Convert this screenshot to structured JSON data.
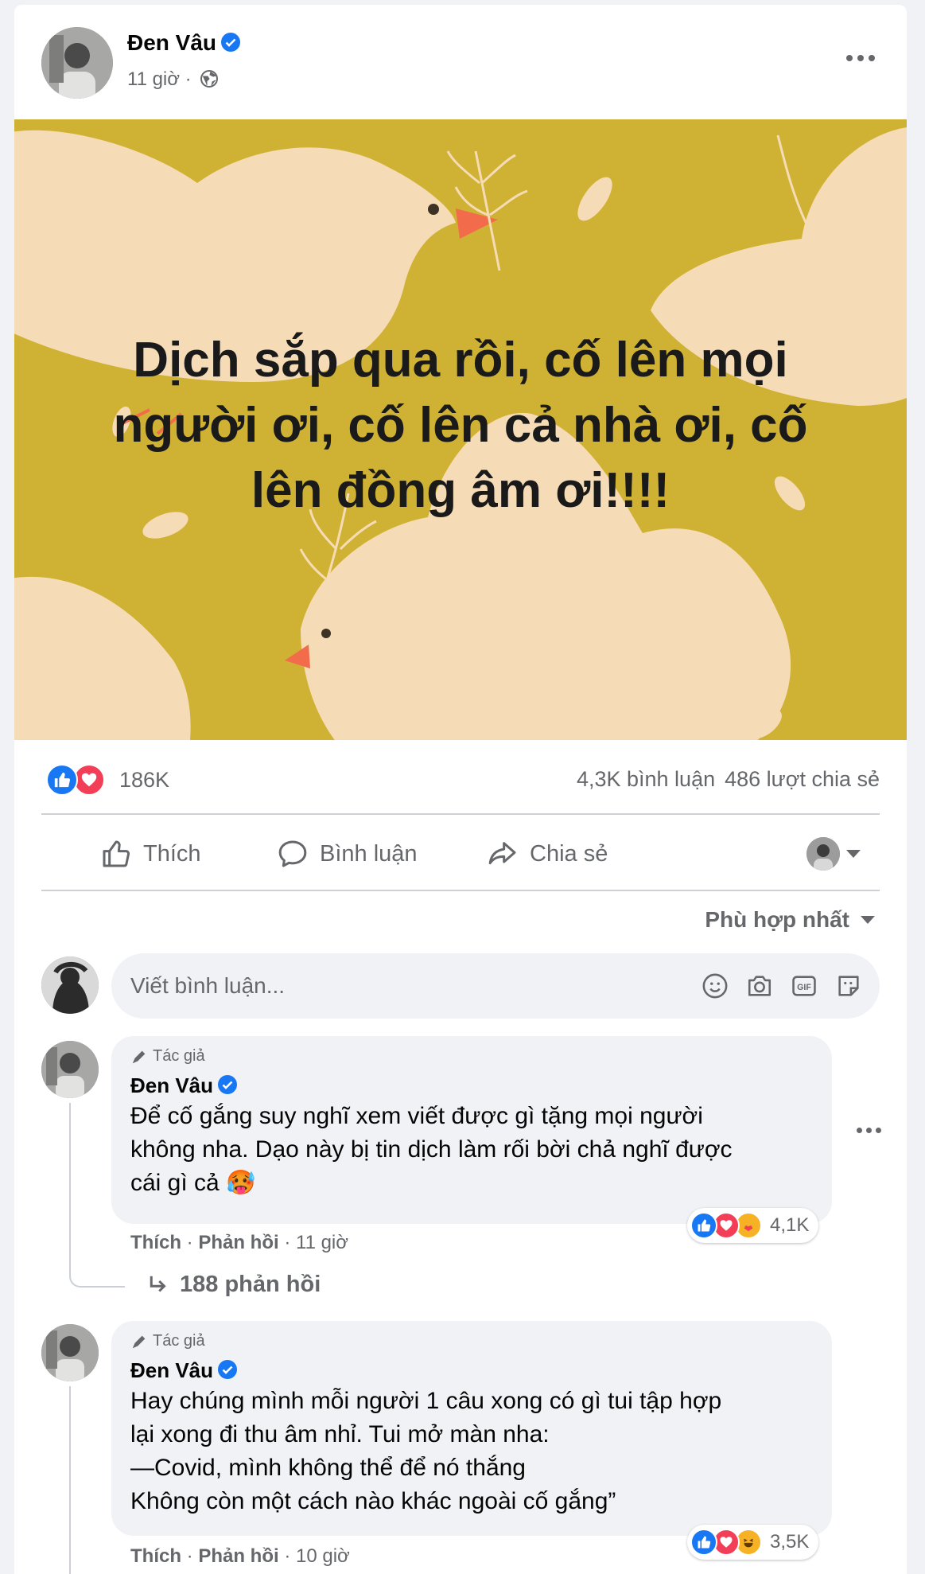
{
  "post": {
    "author": "Đen Vâu",
    "time": "11 giờ ·",
    "image_text": "Dịch sắp qua rồi, cố lên mọi người ơi, cố lên cả nhà ơi, cố lên đồng âm ơi!!!!",
    "reaction_count": "186K",
    "comment_count": "4,3K bình luận",
    "share_count": "486 lượt chia sẻ"
  },
  "actions": {
    "like": "Thích",
    "comment": "Bình luận",
    "share": "Chia sẻ"
  },
  "sort_label": "Phù hợp nhất",
  "comment_box": {
    "placeholder": "Viết bình luận..."
  },
  "comments": [
    {
      "tag": "Tác giả",
      "author": "Đen Vâu",
      "lines": [
        "Để cố gắng suy nghĩ xem viết được gì tặng mọi người",
        "không nha. Dạo này bị tin dịch làm rối bời chả nghĩ được",
        "cái gì cả"
      ],
      "emoji": "🥵",
      "like": "Thích",
      "reply": "Phản hồi",
      "time": "· 11 giờ",
      "reactions": "4,1K",
      "replies": "188 phản hồi"
    },
    {
      "tag": "Tác giả",
      "author": "Đen Vâu",
      "lines": [
        "Hay chúng mình mỗi người 1 câu xong có gì tui tập hợp",
        "lại xong đi thu âm nhỉ. Tui mở màn nha:",
        "—Covid, mình không thể để nó thắng",
        "Không còn một cách nào khác ngoài cố gắng”"
      ],
      "like": "Thích",
      "reply": "Phản hồi",
      "time": "· 10 giờ",
      "reactions": "3,5K"
    }
  ],
  "colors": {
    "image_bg": "#cfb233",
    "bird": "#f6dcb6",
    "beak": "#f26b4b",
    "like_blue": "#1877f2",
    "love_red": "#f33e58"
  }
}
